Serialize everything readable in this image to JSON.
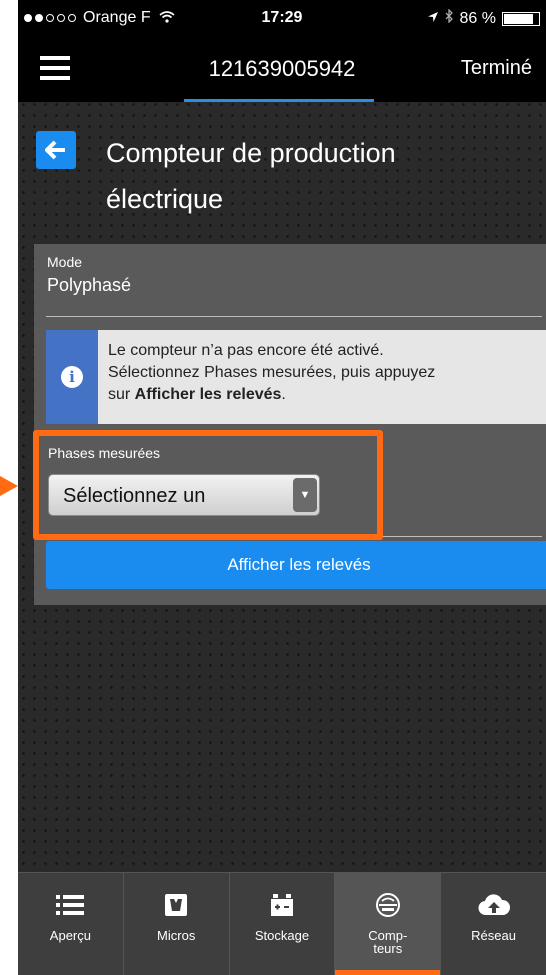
{
  "status_bar": {
    "carrier": "Orange F",
    "time": "17:29",
    "battery": "86 %",
    "battery_level": 0.86
  },
  "nav": {
    "title": "121639005942",
    "done_label": "Terminé"
  },
  "header": {
    "back_icon": "arrow-left-icon",
    "title": "Compteur de production électrique"
  },
  "form": {
    "mode_label": "Mode",
    "mode_value": "Polyphasé",
    "info_line1": "Le compteur n’a pas encore été activé.",
    "info_line2": "Sélectionnez Phases mesurées, puis appuyez",
    "info_line3_prefix": "sur ",
    "info_line3_bold": "Afficher les relevés",
    "info_line3_suffix": ".",
    "phases_label": "Phases mesurées",
    "phases_select_value": "Sélectionnez un",
    "show_readings_label": "Afficher les relevés"
  },
  "tabs": [
    {
      "label": "Aperçu",
      "icon": "list-icon",
      "active": false
    },
    {
      "label": "Micros",
      "icon": "microinverter-icon",
      "active": false
    },
    {
      "label": "Stockage",
      "icon": "battery-storage-icon",
      "active": false
    },
    {
      "label": "Comp-\nteurs",
      "icon": "meter-icon",
      "active": true
    },
    {
      "label": "Réseau",
      "icon": "cloud-upload-icon",
      "active": false
    }
  ],
  "colors": {
    "accent_blue": "#1a8cf0",
    "highlight_orange": "#ff6a13",
    "info_strip": "#4472c4"
  }
}
